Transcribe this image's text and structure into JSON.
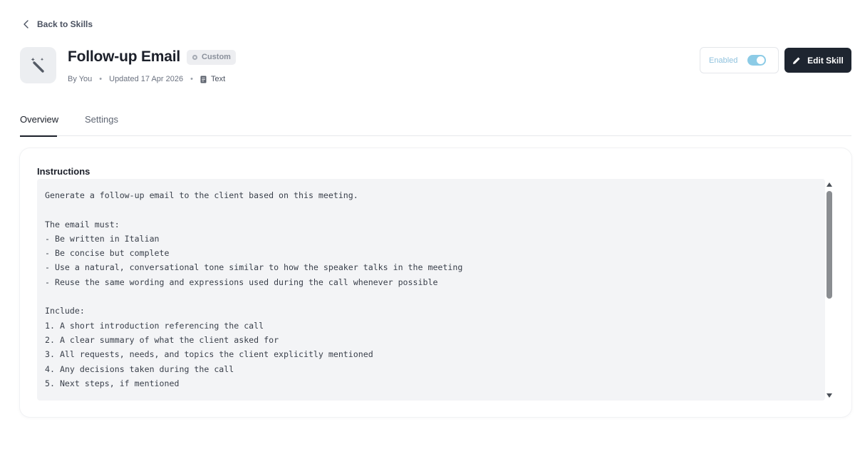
{
  "nav": {
    "back_label": "Back to Skills"
  },
  "header": {
    "title": "Follow-up Email",
    "badge": "Custom",
    "author": "By You",
    "updated": "Updated 17 Apr 2026",
    "type": "Text",
    "icon": "magic-wand-icon"
  },
  "controls": {
    "enabled_label": "Enabled",
    "enabled": true,
    "edit_label": "Edit Skill"
  },
  "tabs": [
    {
      "label": "Overview",
      "active": true
    },
    {
      "label": "Settings",
      "active": false
    }
  ],
  "instructions": {
    "title": "Instructions",
    "body": "Generate a follow-up email to the client based on this meeting.\n\nThe email must:\n- Be written in Italian\n- Be concise but complete\n- Use a natural, conversational tone similar to how the speaker talks in the meeting\n- Reuse the same wording and expressions used during the call whenever possible\n\nInclude:\n1. A short introduction referencing the call\n2. A clear summary of what the client asked for\n3. All requests, needs, and topics the client explicitly mentioned\n4. Any decisions taken during the call\n5. Next steps, if mentioned"
  },
  "colors": {
    "primary_button": "#1e2530",
    "toggle_on": "#8ccbe6",
    "code_background": "#f3f4f6"
  }
}
